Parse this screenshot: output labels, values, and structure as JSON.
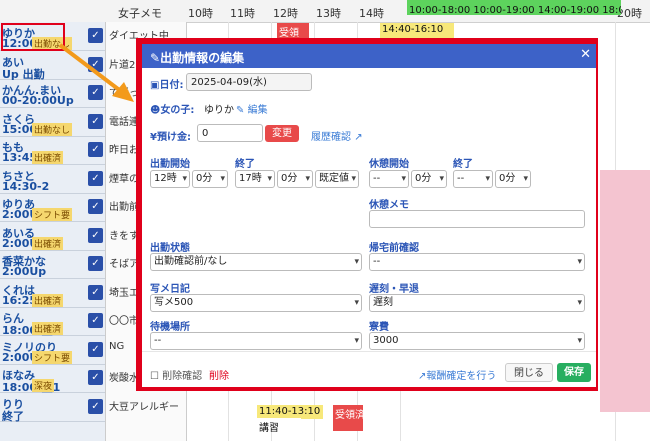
{
  "schedule": {
    "header": {
      "memo_col": "女子メモ",
      "hours": [
        "10時",
        "11時",
        "12時",
        "13時",
        "14時",
        "15時",
        "16時",
        "17時",
        "18時",
        "19時",
        "20時"
      ]
    },
    "rows": [
      {
        "name": "ゆりか",
        "time": "12:00-1",
        "tag": "出勤なし",
        "memo": "ダイエット中"
      },
      {
        "name": "あい",
        "time": "Up 出勤",
        "tag": "",
        "memo": "片道2時間"
      },
      {
        "name": "かんん.まい",
        "time": "00-20:00Up",
        "tag": "",
        "memo": "て通っ"
      },
      {
        "name": "さくら",
        "time": "15:00Up",
        "tag": "出勤なし",
        "memo": "電話連"
      },
      {
        "name": "もも",
        "time": "13:45-18:",
        "tag": "出確済",
        "memo": "昨日お"
      },
      {
        "name": "ちさと",
        "time": "14:30-2",
        "tag": "",
        "memo": "煙草の"
      },
      {
        "name": "ゆりあ",
        "time": "2:00Up",
        "tag": "シフト要",
        "memo": "出勤前"
      },
      {
        "name": "あいる",
        "time": "2:00Up",
        "tag": "出確済",
        "memo": "きをす"
      },
      {
        "name": "香菜かな",
        "time": "2:00Up",
        "tag": "",
        "memo": "そばア"
      },
      {
        "name": "くれは",
        "time": "16:25-",
        "tag": "出確済",
        "memo": "埼玉エ"
      },
      {
        "name": "らん",
        "time": "18:00-翌0",
        "tag": "出確済",
        "memo": "〇〇市"
      },
      {
        "name": "ミノリのり",
        "time": "2:00Up",
        "tag": "シフト要",
        "memo": "NG"
      },
      {
        "name": "ほなみ",
        "time": "18:00-翌1",
        "tag": "深夜",
        "memo": "炭酸水"
      },
      {
        "name": "りり",
        "time": "終了",
        "tag": "",
        "memo": "大豆アレルギー"
      }
    ],
    "blocks": [
      {
        "text": "10:00-18:00 10:00-19:00 14:00-19:00 18:00-翌1:00",
        "color": "#5dd35d"
      },
      {
        "text": "受領",
        "color": "#e84a4a"
      },
      {
        "text": "14:40-16:10",
        "color": "#f7e87a"
      },
      {
        "text": "11:40-13:10",
        "color": "#f7e87a"
      },
      {
        "text": "受領済",
        "color": "#e84a4a"
      },
      {
        "text": "講習",
        "color": "#ffffff"
      }
    ]
  },
  "modal": {
    "title": "出勤情報の編集",
    "date_label": "日付:",
    "date_value": "2025-04-09(水)",
    "girl_label": "女の子:",
    "girl_name": "ゆりか",
    "edit_link": "編集",
    "deposit_label": "¥預け金:",
    "deposit_value": "0",
    "change_button": "変更",
    "history_link": "履歴確認",
    "start_label": "出勤開始",
    "end_label": "終了",
    "start_hour": "12時",
    "start_min": "0分",
    "end_hour": "17時",
    "end_min": "0分",
    "default_select": "既定値",
    "break_start_label": "休憩開始",
    "break_end_label": "終了",
    "break_start_hour": "--",
    "break_start_min": "0分",
    "break_end_hour": "--",
    "break_end_min": "0分",
    "break_memo_label": "休憩メモ",
    "status_label": "出勤状態",
    "status_value": "出勤確認前/なし",
    "return_label": "帰宅前確認",
    "return_value": "--",
    "photo_label": "写メ日記",
    "photo_value": "写メ500",
    "late_label": "遅刻・早退",
    "late_value": "遅刻",
    "wait_label": "待機場所",
    "wait_value": "--",
    "dorm_label": "寮費",
    "dorm_value": "3000",
    "delete_check_label": "削除確認",
    "delete_button": "削除",
    "pay_link": "報酬確定を行う",
    "close_button": "閉じる",
    "save_button": "保存"
  },
  "colors": {
    "accent": "#3d62c8",
    "highlight": "#e0001b",
    "save": "#27ae60",
    "danger": "#e84a4a"
  }
}
